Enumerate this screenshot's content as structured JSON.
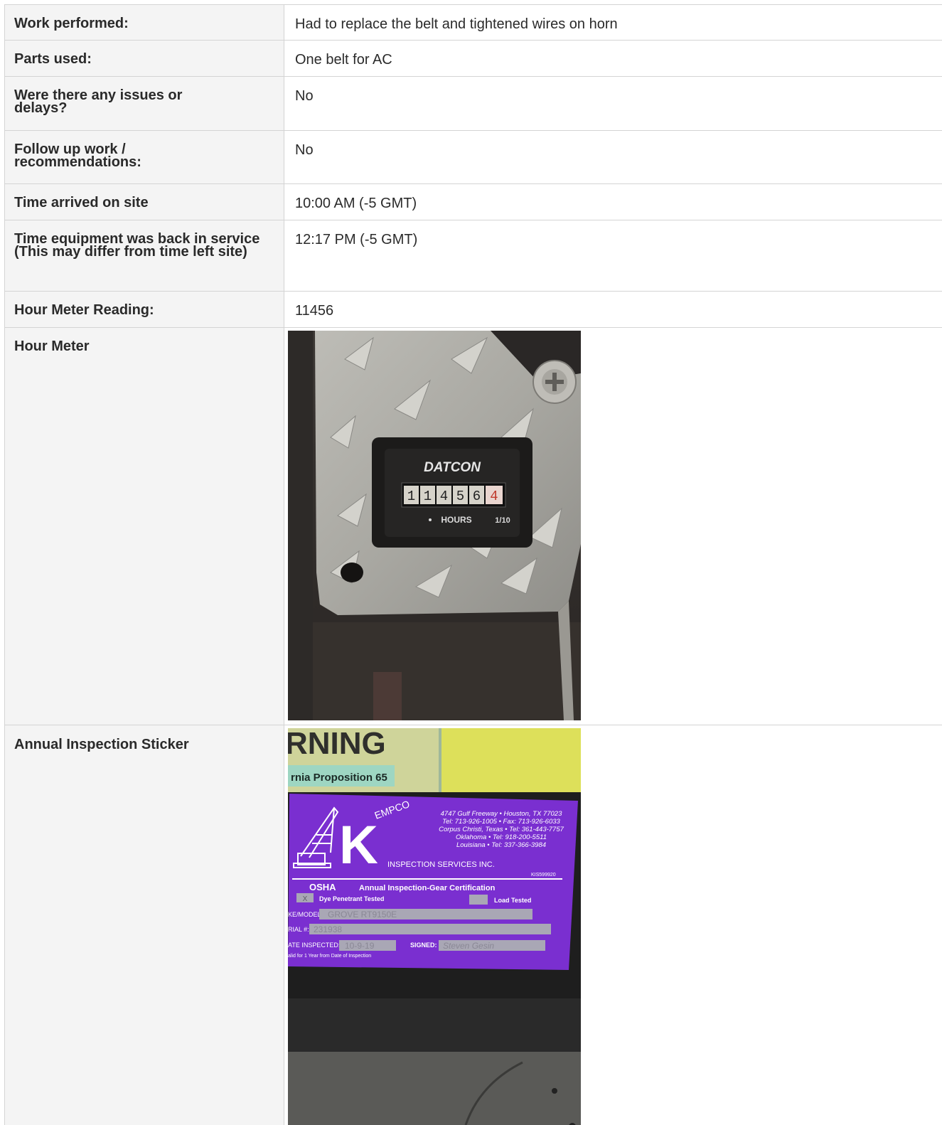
{
  "rows": [
    {
      "label": "Work performed:",
      "value": "Had to replace the belt and tightened wires on horn"
    },
    {
      "label": "Parts used:",
      "value": "One belt for AC"
    },
    {
      "label": "Were there any issues or delays?",
      "value": "No"
    },
    {
      "label": "Follow up work / recommendations:",
      "value": "No"
    },
    {
      "label": "Time arrived on site",
      "value": "10:00 AM (-5 GMT)"
    },
    {
      "label": "Time equipment was back in service (This may differ from time left site)",
      "value": "12:17 PM (-5 GMT)"
    },
    {
      "label": "Hour Meter Reading:",
      "value": "11456"
    }
  ],
  "hour_meter": {
    "label": "Hour Meter",
    "brand": "DATCON",
    "digits": [
      "1",
      "1",
      "4",
      "5",
      "6",
      "4"
    ],
    "unit": "HOURS",
    "fraction": "1/10"
  },
  "sticker": {
    "label": "Annual Inspection Sticker",
    "warning": "RNING",
    "proposition": "rnia Proposition 65",
    "brand_k": "K",
    "brand_rest": "EMPCO",
    "address": [
      "4747 Gulf Freeway • Houston, TX 77023",
      "Tel: 713-926-1005 • Fax: 713-926-6033",
      "Corpus Christi, Texas • Tel: 361-443-7757",
      "Oklahoma • Tel: 918-200-5511",
      "Louisiana • Tel: 337-366-3984"
    ],
    "services": "INSPECTION SERVICES INC.",
    "serial_code": "KIS599920",
    "osha": "OSHA",
    "certification": "Annual Inspection-Gear Certification",
    "dye": "Dye Penetrant Tested",
    "dye_mark": "X",
    "load": "Load Tested",
    "make_label": "KE/MODEL:",
    "make_value": "GROVE   RT9150E",
    "serial_label": "RIAL #:",
    "serial_value": "231938",
    "date_label": "ATE INSPECTED:",
    "date_value": "10-9-19",
    "signed_label": "SIGNED:",
    "signed_value": "Steven Gesin",
    "valid": "alid for 1 Year from Date of Inspection"
  },
  "colors": {
    "label_bg": "#f4f4f4",
    "border": "#d4d4d4",
    "sticker_purple": "#7a2fd0",
    "warning_yellow": "#d9d45a"
  }
}
